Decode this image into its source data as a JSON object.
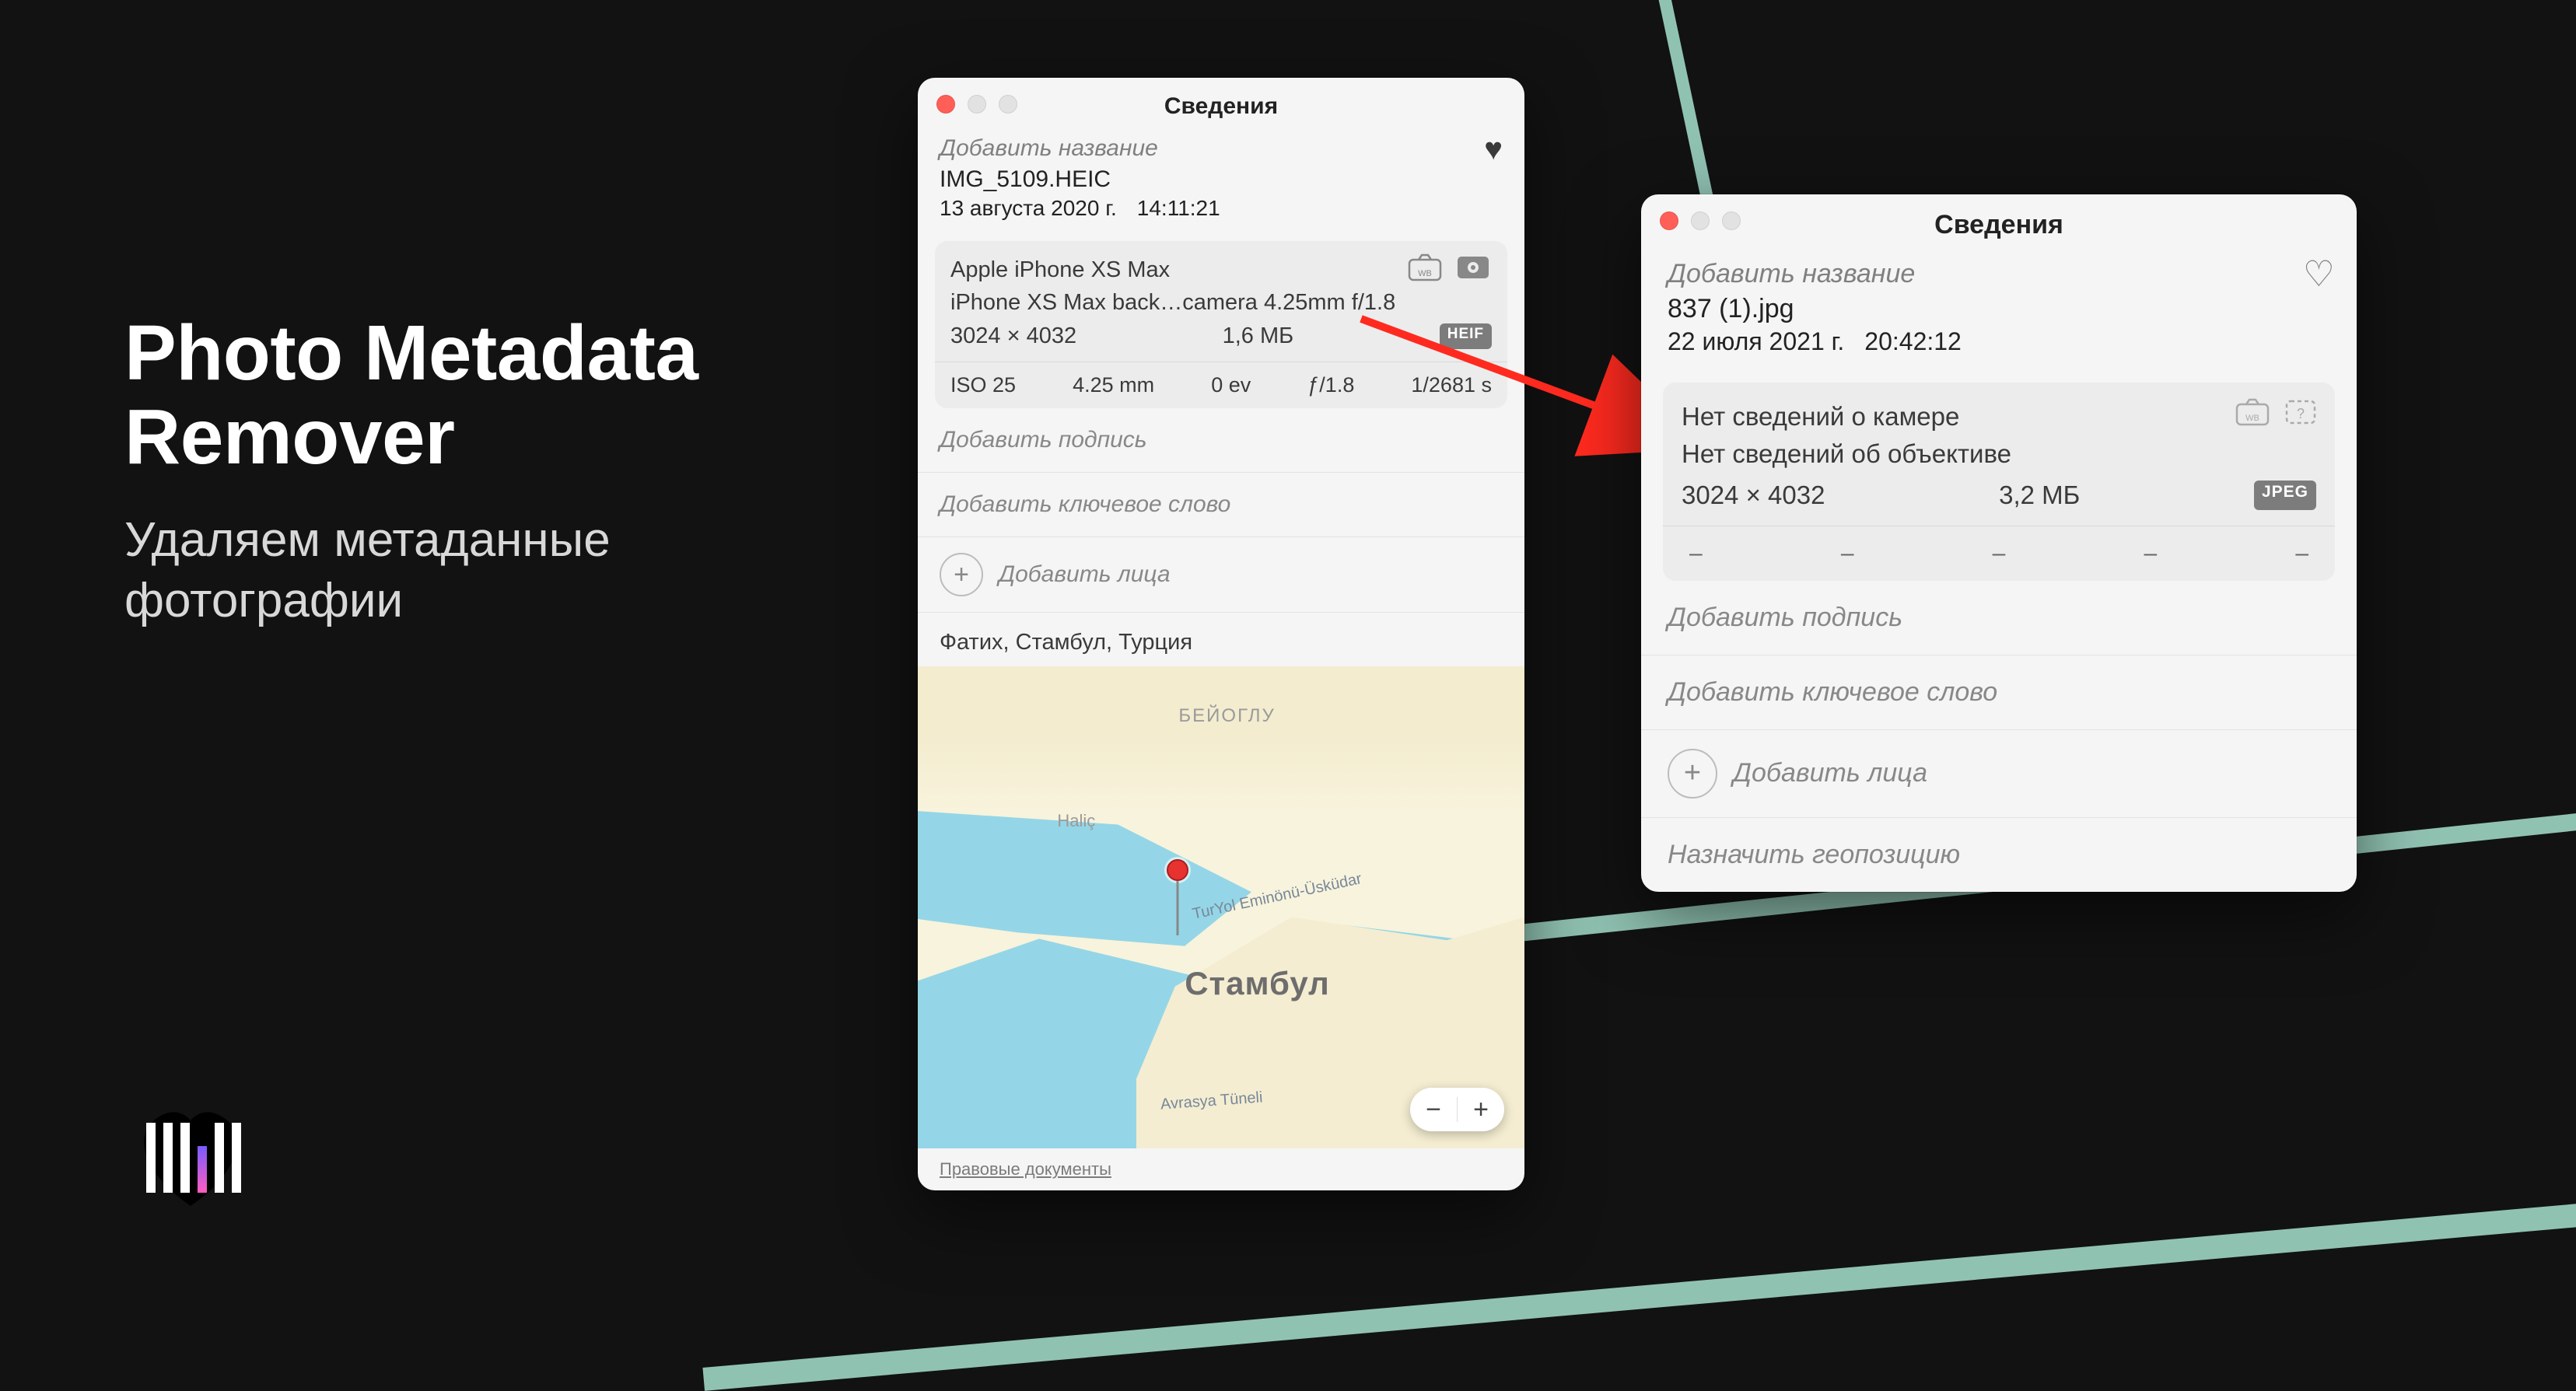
{
  "heading": {
    "title_line1": "Photo Metadata",
    "title_line2": "Remover",
    "subtitle_line1": "Удаляем метаданные",
    "subtitle_line2": "фотографии"
  },
  "window_before": {
    "title": "Сведения",
    "add_title_placeholder": "Добавить название",
    "filename": "IMG_5109.HEIC",
    "date": "13 августа 2020 г.",
    "time": "14:11:21",
    "heart_filled": true,
    "camera": "Apple iPhone XS Max",
    "lens": "iPhone XS Max back…camera 4.25mm f/1.8",
    "dimensions": "3024 × 4032",
    "filesize": "1,6 МБ",
    "format_badge": "HEIF",
    "exif": {
      "iso": "ISO 25",
      "focal": "4.25 mm",
      "ev": "0 ev",
      "aperture": "ƒ/1.8",
      "shutter": "1/2681 s"
    },
    "add_caption": "Добавить подпись",
    "add_keyword": "Добавить ключевое слово",
    "add_faces": "Добавить лица",
    "location": "Фатих, Стамбул, Турция",
    "map": {
      "city": "Стамбул",
      "district": "БЕЙОГЛУ",
      "water": "Haliç",
      "tunnel": "Avrasya Tüneli",
      "ferry": "TurYol Eminönü-Üsküdar"
    },
    "legal": "Правовые документы"
  },
  "window_after": {
    "title": "Сведения",
    "add_title_placeholder": "Добавить название",
    "filename": "837 (1).jpg",
    "date": "22 июля 2021 г.",
    "time": "20:42:12",
    "heart_filled": false,
    "no_camera": "Нет сведений о камере",
    "no_lens": "Нет сведений об объективе",
    "dimensions": "3024 × 4032",
    "filesize": "3,2 МБ",
    "format_badge": "JPEG",
    "dash": "–",
    "add_caption": "Добавить подпись",
    "add_keyword": "Добавить ключевое слово",
    "add_faces": "Добавить лица",
    "assign_geo": "Назначить геопозицию"
  }
}
